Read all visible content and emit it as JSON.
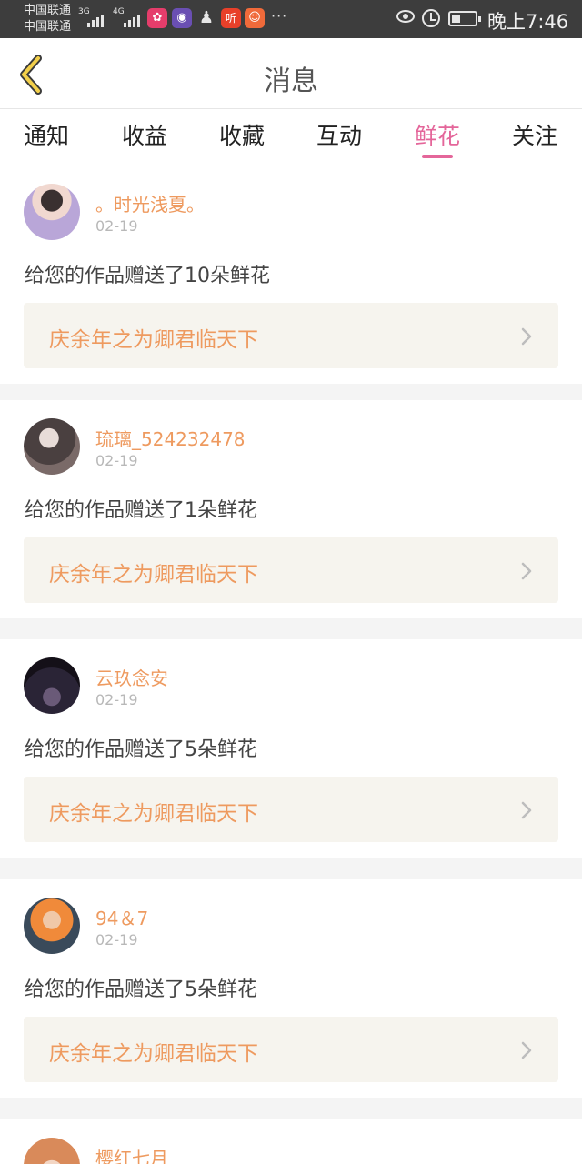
{
  "status_bar": {
    "carrier_1": "中国联通",
    "carrier_2": "中国联通",
    "sig_1": "3G",
    "sig_2": "4G",
    "app_ting": "听",
    "more": "···",
    "time": "晚上7:46",
    "battery_level": 0.35
  },
  "nav": {
    "title": "消息",
    "back_icon": "chevron-left-icon"
  },
  "tabs": [
    {
      "label": "通知",
      "active": false
    },
    {
      "label": "收益",
      "active": false
    },
    {
      "label": "收藏",
      "active": false
    },
    {
      "label": "互动",
      "active": false
    },
    {
      "label": "鲜花",
      "active": true
    },
    {
      "label": "关注",
      "active": false
    }
  ],
  "colors": {
    "accent": "#e4669a",
    "username": "#ee9a5f",
    "card_bg": "#f6f4ee"
  },
  "items": [
    {
      "username": "。时光浅夏。",
      "date": "02-19",
      "message": "给您的作品赠送了10朵鲜花",
      "work_title": "庆余年之为卿君临天下"
    },
    {
      "username": "琉璃_524232478",
      "date": "02-19",
      "message": "给您的作品赠送了1朵鲜花",
      "work_title": "庆余年之为卿君临天下"
    },
    {
      "username": "云玖念安",
      "date": "02-19",
      "message": "给您的作品赠送了5朵鲜花",
      "work_title": "庆余年之为卿君临天下"
    },
    {
      "username": "94＆7",
      "date": "02-19",
      "message": "给您的作品赠送了5朵鲜花",
      "work_title": "庆余年之为卿君临天下"
    },
    {
      "username": "樱红七月",
      "date": "",
      "message": "",
      "work_title": ""
    }
  ]
}
